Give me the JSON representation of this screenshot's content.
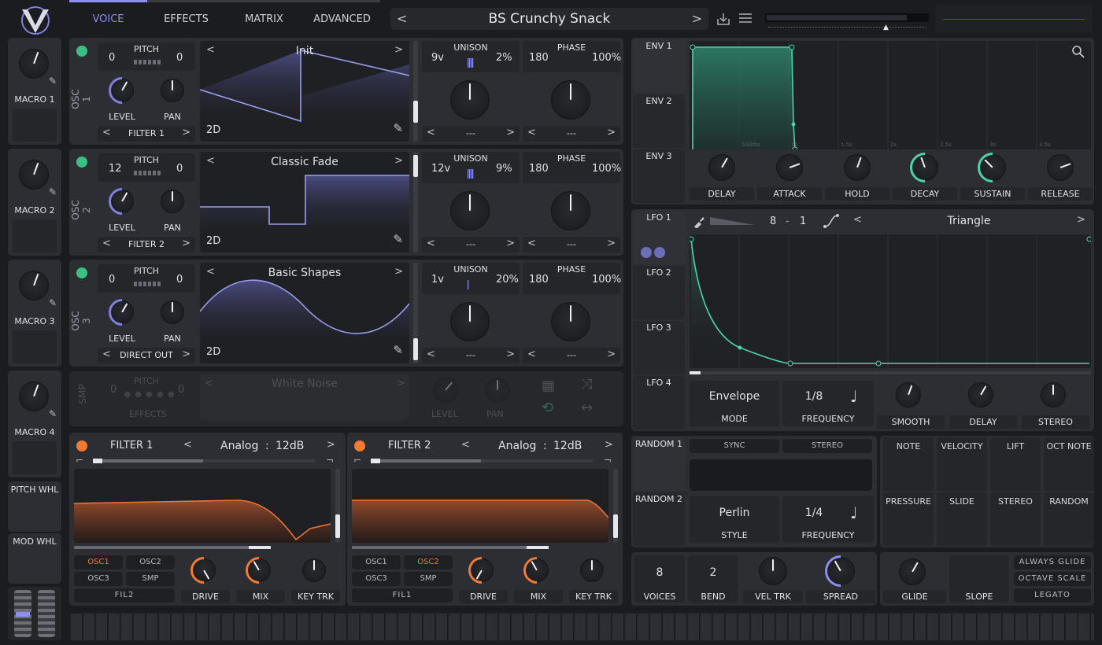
{
  "header": {
    "tabs": [
      {
        "label": "VOICE",
        "active": true
      },
      {
        "label": "EFFECTS"
      },
      {
        "label": "MATRIX"
      },
      {
        "label": "ADVANCED"
      }
    ],
    "preset_name": "BS Crunchy Snack",
    "accent": "#8c8ff0"
  },
  "macros": [
    "MACRO 1",
    "MACRO 2",
    "MACRO 3",
    "MACRO 4"
  ],
  "wheels": {
    "pitch": "PITCH WHL",
    "mod": "MOD WHL"
  },
  "oscillators": [
    {
      "name": "OSC 1",
      "pitch_label": "PITCH",
      "pitch_left": "0",
      "pitch_right": "0",
      "level": "LEVEL",
      "pan": "PAN",
      "dest": "FILTER 1",
      "wavetable": "Init",
      "dim": "2D",
      "unison_label": "UNISON",
      "voices": "9v",
      "detune": "2%",
      "phase_label": "PHASE",
      "phase": "180",
      "phase_pct": "100%",
      "sel1": "---",
      "sel2": "---"
    },
    {
      "name": "OSC 2",
      "pitch_label": "PITCH",
      "pitch_left": "12",
      "pitch_right": "0",
      "level": "LEVEL",
      "pan": "PAN",
      "dest": "FILTER 2",
      "wavetable": "Classic Fade",
      "dim": "2D",
      "unison_label": "UNISON",
      "voices": "12v",
      "detune": "9%",
      "phase_label": "PHASE",
      "phase": "180",
      "phase_pct": "100%",
      "sel1": "---",
      "sel2": "---"
    },
    {
      "name": "OSC 3",
      "pitch_label": "PITCH",
      "pitch_left": "0",
      "pitch_right": "0",
      "level": "LEVEL",
      "pan": "PAN",
      "dest": "DIRECT OUT",
      "wavetable": "Basic Shapes",
      "dim": "2D",
      "unison_label": "UNISON",
      "voices": "1v",
      "detune": "20%",
      "phase_label": "PHASE",
      "phase": "180",
      "phase_pct": "100%",
      "sel1": "---",
      "sel2": "---"
    }
  ],
  "sampler": {
    "name": "SMP",
    "pitch_label": "PITCH",
    "pitch_left": "0",
    "pitch_right": "0",
    "dest": "EFFECTS",
    "sample": "White Noise",
    "level": "LEVEL",
    "pan": "PAN"
  },
  "filters": [
    {
      "name": "FILTER 1",
      "model": "Analog",
      "slope": "12dB",
      "sources": [
        "OSC1",
        "OSC2",
        "OSC3",
        "SMP"
      ],
      "active_sources": [
        "OSC1"
      ],
      "chain": "FIL2",
      "knobs": [
        "DRIVE",
        "MIX",
        "KEY TRK"
      ]
    },
    {
      "name": "FILTER 2",
      "model": "Analog",
      "slope": "12dB",
      "sources": [
        "OSC1",
        "OSC2",
        "OSC3",
        "SMP"
      ],
      "active_sources": [
        "OSC2"
      ],
      "chain": "FIL1",
      "knobs": [
        "DRIVE",
        "MIX",
        "KEY TRK"
      ]
    }
  ],
  "filter_sep": ":",
  "envelopes": {
    "tabs": [
      "ENV 1",
      "ENV 2",
      "ENV 3"
    ],
    "time_labels": [
      "500ms",
      "1s",
      "1.5s",
      "2s",
      "2.5s",
      "3s",
      "3.5s"
    ],
    "knobs": [
      "DELAY",
      "ATTACK",
      "HOLD",
      "DECAY",
      "SUSTAIN",
      "RELEASE"
    ]
  },
  "lfos": {
    "tabs": [
      "LFO 1",
      "LFO 2",
      "LFO 3",
      "LFO 4"
    ],
    "grid_left": "8",
    "grid_sep": "-",
    "grid_right": "1",
    "shape": "Triangle",
    "mode_value": "Envelope",
    "mode_label": "MODE",
    "freq_value": "1/8",
    "freq_label": "FREQUENCY",
    "knobs": [
      "SMOOTH",
      "DELAY",
      "STEREO"
    ]
  },
  "random": {
    "tabs": [
      "RANDOM 1",
      "RANDOM 2"
    ],
    "sync": "SYNC",
    "stereo": "STEREO",
    "style_value": "Perlin",
    "style_label": "STYLE",
    "freq_value": "1/4",
    "freq_label": "FREQUENCY"
  },
  "mod_sources": [
    "NOTE",
    "VELOCITY",
    "LIFT",
    "OCT NOTE",
    "PRESSURE",
    "SLIDE",
    "STEREO",
    "RANDOM"
  ],
  "voice": {
    "voices_value": "8",
    "voices_label": "VOICES",
    "bend_value": "2",
    "bend_label": "BEND",
    "veltrk": "VEL TRK",
    "spread": "SPREAD",
    "glide": "GLIDE",
    "slope": "SLOPE",
    "options": [
      "ALWAYS GLIDE",
      "OCTAVE SCALE",
      "LEGATO"
    ]
  }
}
